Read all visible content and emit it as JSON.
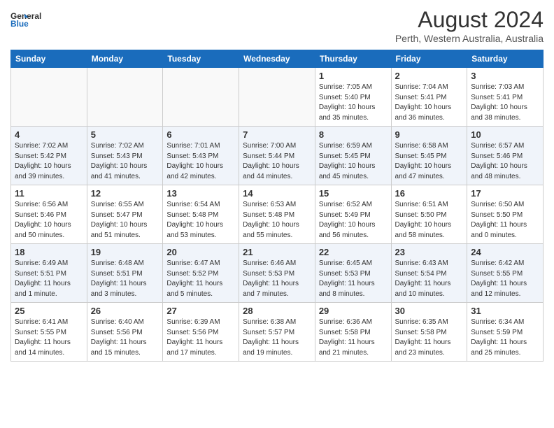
{
  "header": {
    "logo_line1": "General",
    "logo_line2": "Blue",
    "month_year": "August 2024",
    "location": "Perth, Western Australia, Australia"
  },
  "days_of_week": [
    "Sunday",
    "Monday",
    "Tuesday",
    "Wednesday",
    "Thursday",
    "Friday",
    "Saturday"
  ],
  "weeks": [
    [
      {
        "day": "",
        "info": ""
      },
      {
        "day": "",
        "info": ""
      },
      {
        "day": "",
        "info": ""
      },
      {
        "day": "",
        "info": ""
      },
      {
        "day": "1",
        "info": "Sunrise: 7:05 AM\nSunset: 5:40 PM\nDaylight: 10 hours\nand 35 minutes."
      },
      {
        "day": "2",
        "info": "Sunrise: 7:04 AM\nSunset: 5:41 PM\nDaylight: 10 hours\nand 36 minutes."
      },
      {
        "day": "3",
        "info": "Sunrise: 7:03 AM\nSunset: 5:41 PM\nDaylight: 10 hours\nand 38 minutes."
      }
    ],
    [
      {
        "day": "4",
        "info": "Sunrise: 7:02 AM\nSunset: 5:42 PM\nDaylight: 10 hours\nand 39 minutes."
      },
      {
        "day": "5",
        "info": "Sunrise: 7:02 AM\nSunset: 5:43 PM\nDaylight: 10 hours\nand 41 minutes."
      },
      {
        "day": "6",
        "info": "Sunrise: 7:01 AM\nSunset: 5:43 PM\nDaylight: 10 hours\nand 42 minutes."
      },
      {
        "day": "7",
        "info": "Sunrise: 7:00 AM\nSunset: 5:44 PM\nDaylight: 10 hours\nand 44 minutes."
      },
      {
        "day": "8",
        "info": "Sunrise: 6:59 AM\nSunset: 5:45 PM\nDaylight: 10 hours\nand 45 minutes."
      },
      {
        "day": "9",
        "info": "Sunrise: 6:58 AM\nSunset: 5:45 PM\nDaylight: 10 hours\nand 47 minutes."
      },
      {
        "day": "10",
        "info": "Sunrise: 6:57 AM\nSunset: 5:46 PM\nDaylight: 10 hours\nand 48 minutes."
      }
    ],
    [
      {
        "day": "11",
        "info": "Sunrise: 6:56 AM\nSunset: 5:46 PM\nDaylight: 10 hours\nand 50 minutes."
      },
      {
        "day": "12",
        "info": "Sunrise: 6:55 AM\nSunset: 5:47 PM\nDaylight: 10 hours\nand 51 minutes."
      },
      {
        "day": "13",
        "info": "Sunrise: 6:54 AM\nSunset: 5:48 PM\nDaylight: 10 hours\nand 53 minutes."
      },
      {
        "day": "14",
        "info": "Sunrise: 6:53 AM\nSunset: 5:48 PM\nDaylight: 10 hours\nand 55 minutes."
      },
      {
        "day": "15",
        "info": "Sunrise: 6:52 AM\nSunset: 5:49 PM\nDaylight: 10 hours\nand 56 minutes."
      },
      {
        "day": "16",
        "info": "Sunrise: 6:51 AM\nSunset: 5:50 PM\nDaylight: 10 hours\nand 58 minutes."
      },
      {
        "day": "17",
        "info": "Sunrise: 6:50 AM\nSunset: 5:50 PM\nDaylight: 11 hours\nand 0 minutes."
      }
    ],
    [
      {
        "day": "18",
        "info": "Sunrise: 6:49 AM\nSunset: 5:51 PM\nDaylight: 11 hours\nand 1 minute."
      },
      {
        "day": "19",
        "info": "Sunrise: 6:48 AM\nSunset: 5:51 PM\nDaylight: 11 hours\nand 3 minutes."
      },
      {
        "day": "20",
        "info": "Sunrise: 6:47 AM\nSunset: 5:52 PM\nDaylight: 11 hours\nand 5 minutes."
      },
      {
        "day": "21",
        "info": "Sunrise: 6:46 AM\nSunset: 5:53 PM\nDaylight: 11 hours\nand 7 minutes."
      },
      {
        "day": "22",
        "info": "Sunrise: 6:45 AM\nSunset: 5:53 PM\nDaylight: 11 hours\nand 8 minutes."
      },
      {
        "day": "23",
        "info": "Sunrise: 6:43 AM\nSunset: 5:54 PM\nDaylight: 11 hours\nand 10 minutes."
      },
      {
        "day": "24",
        "info": "Sunrise: 6:42 AM\nSunset: 5:55 PM\nDaylight: 11 hours\nand 12 minutes."
      }
    ],
    [
      {
        "day": "25",
        "info": "Sunrise: 6:41 AM\nSunset: 5:55 PM\nDaylight: 11 hours\nand 14 minutes."
      },
      {
        "day": "26",
        "info": "Sunrise: 6:40 AM\nSunset: 5:56 PM\nDaylight: 11 hours\nand 15 minutes."
      },
      {
        "day": "27",
        "info": "Sunrise: 6:39 AM\nSunset: 5:56 PM\nDaylight: 11 hours\nand 17 minutes."
      },
      {
        "day": "28",
        "info": "Sunrise: 6:38 AM\nSunset: 5:57 PM\nDaylight: 11 hours\nand 19 minutes."
      },
      {
        "day": "29",
        "info": "Sunrise: 6:36 AM\nSunset: 5:58 PM\nDaylight: 11 hours\nand 21 minutes."
      },
      {
        "day": "30",
        "info": "Sunrise: 6:35 AM\nSunset: 5:58 PM\nDaylight: 11 hours\nand 23 minutes."
      },
      {
        "day": "31",
        "info": "Sunrise: 6:34 AM\nSunset: 5:59 PM\nDaylight: 11 hours\nand 25 minutes."
      }
    ]
  ]
}
